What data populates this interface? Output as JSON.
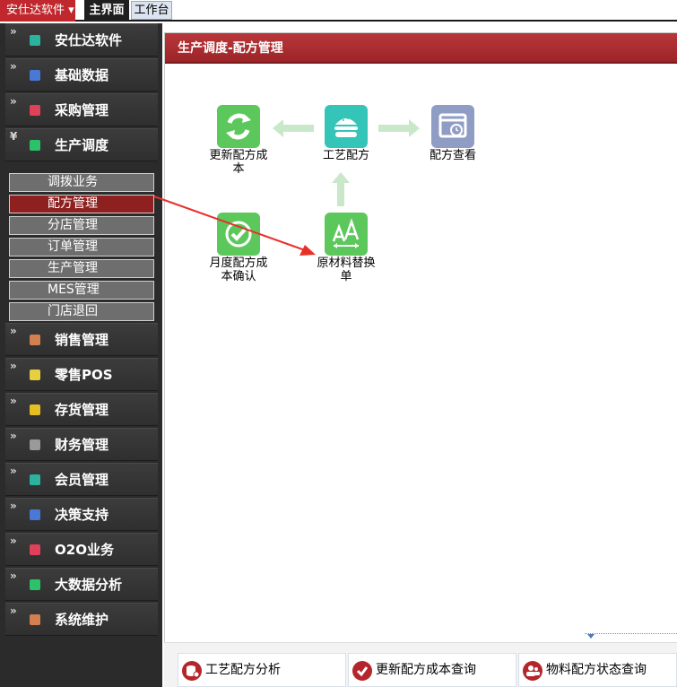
{
  "topbar": {
    "app_menu": "安仕达软件 ▾",
    "tabs": [
      "主界面",
      "工作台"
    ]
  },
  "sidebar": {
    "groups": [
      {
        "label": "安仕达软件",
        "color": "#2bb3a0"
      },
      {
        "label": "基础数据",
        "color": "#4a78d6"
      },
      {
        "label": "采购管理",
        "color": "#e0405a"
      },
      {
        "label": "生产调度",
        "color": "#2cc26a"
      },
      {
        "label": "销售管理",
        "color": "#d28050"
      },
      {
        "label": "零售POS",
        "color": "#e6d040"
      },
      {
        "label": "存货管理",
        "color": "#e6c020"
      },
      {
        "label": "财务管理",
        "color": "#9a9a9a"
      },
      {
        "label": "会员管理",
        "color": "#2bb3a0"
      },
      {
        "label": "决策支持",
        "color": "#4a78d6"
      },
      {
        "label": "O2O业务",
        "color": "#e0405a"
      },
      {
        "label": "大数据分析",
        "color": "#2cc26a"
      },
      {
        "label": "系统维护",
        "color": "#d28050"
      }
    ],
    "chevrons": [
      "»",
      "»",
      "»",
      "»",
      "»",
      "»",
      "»",
      "»",
      "»",
      "»",
      "»",
      "»"
    ],
    "expanded_chevron": "¥",
    "sub_items": [
      "调拨业务",
      "配方管理",
      "分店管理",
      "订单管理",
      "生产管理",
      "MES管理",
      "门店退回"
    ],
    "active_sub_item": "配方管理"
  },
  "main": {
    "title": "生产调度-配方管理",
    "nodes": [
      {
        "id": "update-cost",
        "caption_1": "更新配方成",
        "caption_2": "本",
        "icon": "refresh-icon",
        "color": "#5cc85c"
      },
      {
        "id": "process-recipe",
        "caption_1": "工艺配方",
        "caption_2": "",
        "icon": "burger-icon",
        "color": "#35c4b8"
      },
      {
        "id": "recipe-view",
        "caption_1": "配方查看",
        "caption_2": "",
        "icon": "calendar-clock-icon",
        "color": "#8f9cc4"
      },
      {
        "id": "monthly-cost",
        "caption_1": "月度配方成",
        "caption_2": "本确认",
        "icon": "check-icon",
        "color": "#5cc85c"
      },
      {
        "id": "material-replace",
        "caption_1": "原材料替换",
        "caption_2": "单",
        "icon": "font-size-icon",
        "color": "#5cc85c"
      }
    ]
  },
  "bottom": {
    "links": [
      {
        "label": "工艺配方分析",
        "icon": "database-icon"
      },
      {
        "label": "更新配方成本查询",
        "icon": "check-circle-icon"
      },
      {
        "label": "物料配方状态查询",
        "icon": "users-icon"
      }
    ]
  },
  "colors": {
    "accent_red": "#a8282c",
    "flow_arrow": "#c9e8c9",
    "annotation_arrow": "#e8302a"
  }
}
